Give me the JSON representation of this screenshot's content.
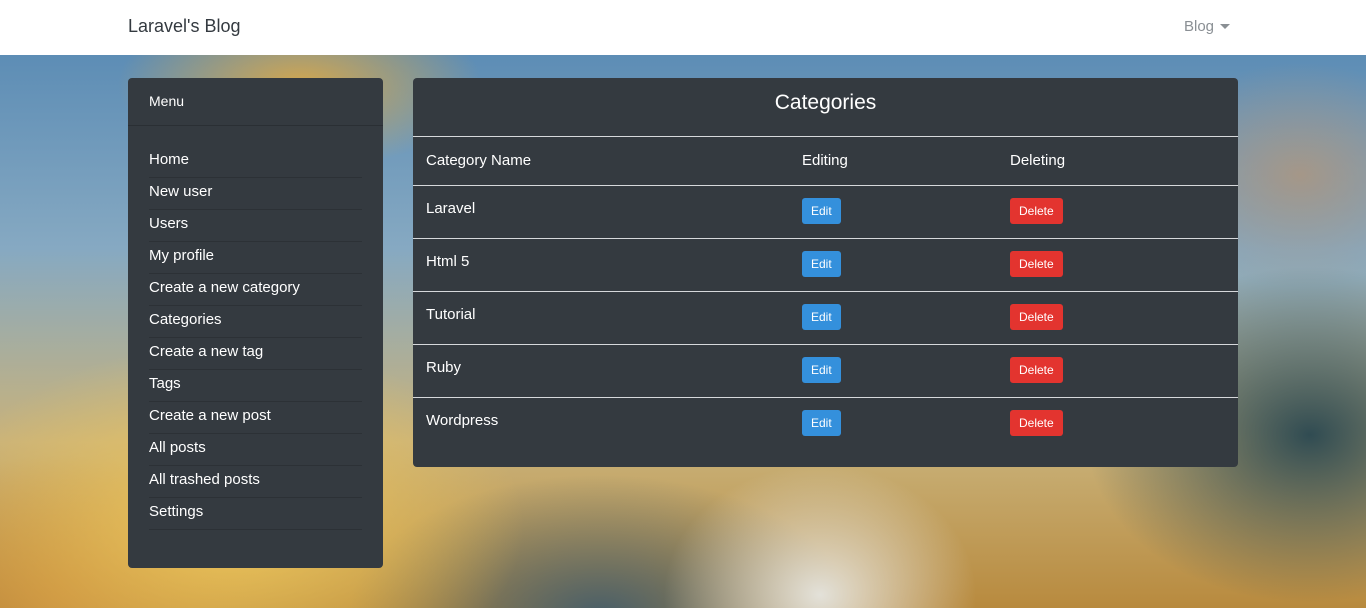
{
  "navbar": {
    "brand": "Laravel's Blog",
    "dropdown_label": "Blog"
  },
  "sidebar": {
    "header": "Menu",
    "items": [
      {
        "label": "Home"
      },
      {
        "label": "New user"
      },
      {
        "label": "Users"
      },
      {
        "label": "My profile"
      },
      {
        "label": "Create a new category"
      },
      {
        "label": "Categories"
      },
      {
        "label": "Create a new tag"
      },
      {
        "label": "Tags"
      },
      {
        "label": "Create a new post"
      },
      {
        "label": "All posts"
      },
      {
        "label": "All trashed posts"
      },
      {
        "label": "Settings"
      }
    ]
  },
  "main": {
    "title": "Categories",
    "columns": [
      "Category Name",
      "Editing",
      "Deleting"
    ],
    "rows": [
      {
        "name": "Laravel",
        "edit": "Edit",
        "delete": "Delete"
      },
      {
        "name": "Html 5",
        "edit": "Edit",
        "delete": "Delete"
      },
      {
        "name": "Tutorial",
        "edit": "Edit",
        "delete": "Delete"
      },
      {
        "name": "Ruby",
        "edit": "Edit",
        "delete": "Delete"
      },
      {
        "name": "Wordpress",
        "edit": "Edit",
        "delete": "Delete"
      }
    ]
  },
  "colors": {
    "panel_bg": "#343a40",
    "edit_button": "#3490dc",
    "delete_button": "#e3342f"
  }
}
